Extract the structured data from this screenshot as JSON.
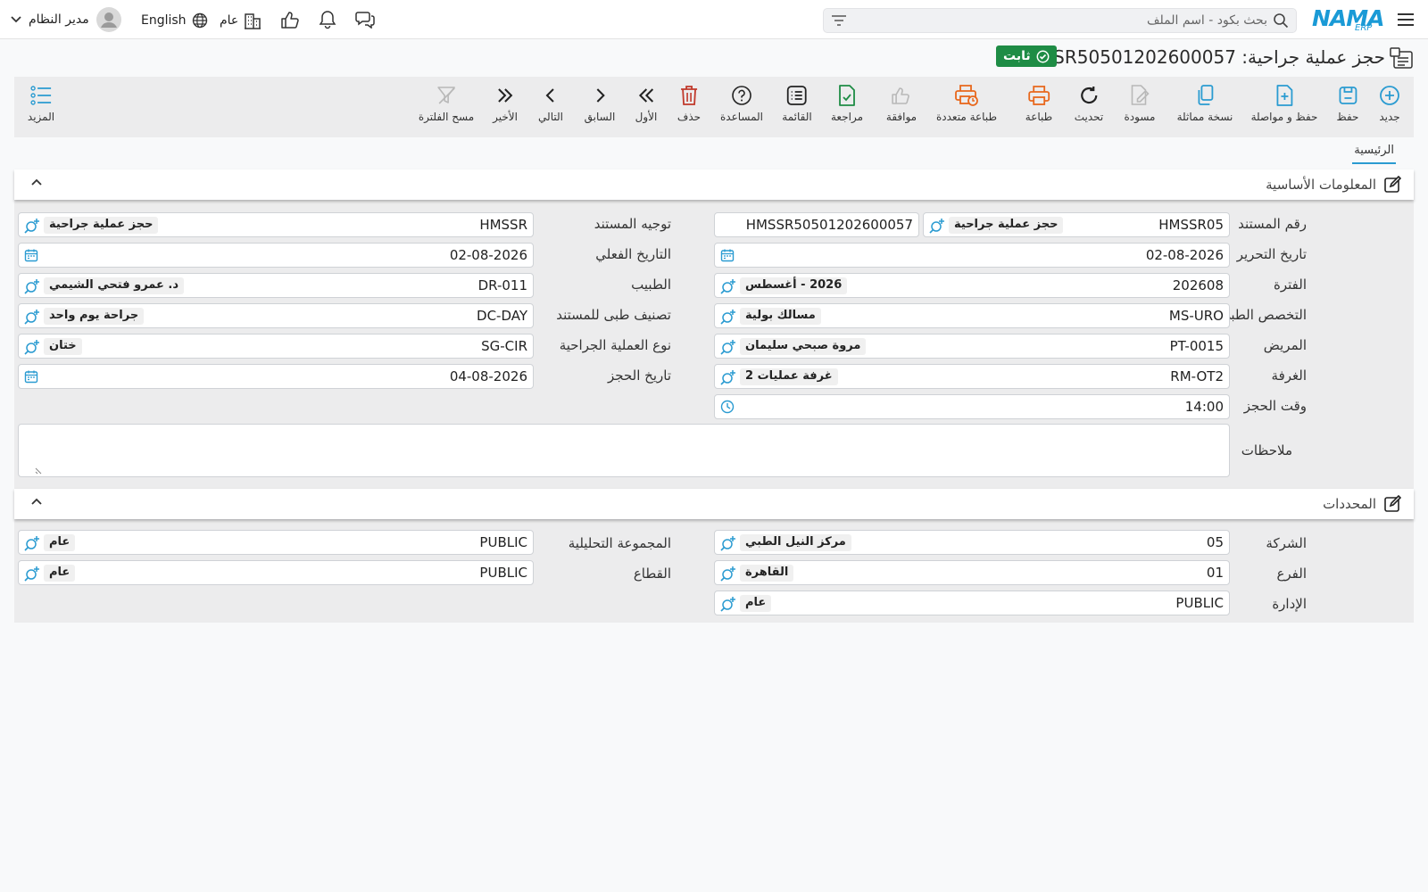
{
  "topbar": {
    "brand": "NAMA",
    "brand_sub": "ERP",
    "search_placeholder": "بحث بكود - اسم الملف",
    "language": "English",
    "company_scope": "عام",
    "user_name": "مدير النظام"
  },
  "document": {
    "title": "حجز عملية جراحية: HMSSR50501202600057",
    "status": "ثابت",
    "status_color": "#1e8c45"
  },
  "toolbar": {
    "new": "جديد",
    "save": "حفظ",
    "save_continue": "حفظ و مواصلة",
    "duplicate": "نسخة مماثلة",
    "draft": "مسودة",
    "refresh": "تحديث",
    "print": "طباعة",
    "multi_print": "طباعة متعددة",
    "approve": "موافقة",
    "review": "مراجعة",
    "list": "القائمة",
    "help": "المساعدة",
    "delete": "حذف",
    "first": "الأول",
    "previous": "السابق",
    "next": "التالي",
    "last": "الأخير",
    "clear_filter": "مسح الفلترة",
    "more": "المزيد"
  },
  "tabs": {
    "main": "الرئيسية"
  },
  "basic": {
    "title": "المعلومات الأساسية",
    "doc_number_label": "رقم المستند",
    "doc_number_code": "HMSSR05",
    "doc_number_name": "حجز عملية جراحية",
    "doc_number_full": "HMSSR50501202600057",
    "doc_direction_label": "توجيه المستند",
    "doc_direction_code": "HMSSR",
    "doc_direction_name": "حجز عملية جراحية",
    "edit_date_label": "تاريخ التحرير",
    "edit_date": "02-08-2026",
    "actual_date_label": "التاريخ الفعلي",
    "actual_date": "02-08-2026",
    "period_label": "الفترة",
    "period_code": "202608",
    "period_name": "2026 - أغسطس",
    "doctor_label": "الطبيب",
    "doctor_code": "DR-011",
    "doctor_name": "د. عمرو فتحي الشيمي",
    "specialty_label": "التخصص الطبي",
    "specialty_code": "MS-URO",
    "specialty_name": "مسالك بولية",
    "classification_label": "تصنيف طبى للمستند",
    "classification_code": "DC-DAY",
    "classification_name": "جراحة يوم واحد",
    "patient_label": "المريض",
    "patient_code": "PT-0015",
    "patient_name": "مروة صبحي سليمان",
    "surgery_type_label": "نوع العملية الجراحية",
    "surgery_type_code": "SG-CIR",
    "surgery_type_name": "ختان",
    "room_label": "الغرفة",
    "room_code": "RM-OT2",
    "room_name": "غرفة عمليات 2",
    "booking_date_label": "تاريخ الحجز",
    "booking_date": "04-08-2026",
    "booking_time_label": "وقت الحجز",
    "booking_time": "14:00",
    "notes_label": "ملاحظات"
  },
  "dimensions": {
    "title": "المحددات",
    "company_label": "الشركة",
    "company_code": "05",
    "company_name": "مركز النيل الطبي",
    "analysis_group_label": "المجموعة التحليلية",
    "analysis_group_code": "PUBLIC",
    "analysis_group_name": "عام",
    "branch_label": "الفرع",
    "branch_code": "01",
    "branch_name": "القاهرة",
    "sector_label": "القطاع",
    "sector_code": "PUBLIC",
    "sector_name": "عام",
    "department_label": "الإدارة",
    "department_code": "PUBLIC",
    "department_name": "عام"
  },
  "colors": {
    "accent": "#2a9bd1",
    "print_orange": "#e8671c",
    "delete_red": "#c0392b",
    "review_green": "#1e8c45"
  }
}
